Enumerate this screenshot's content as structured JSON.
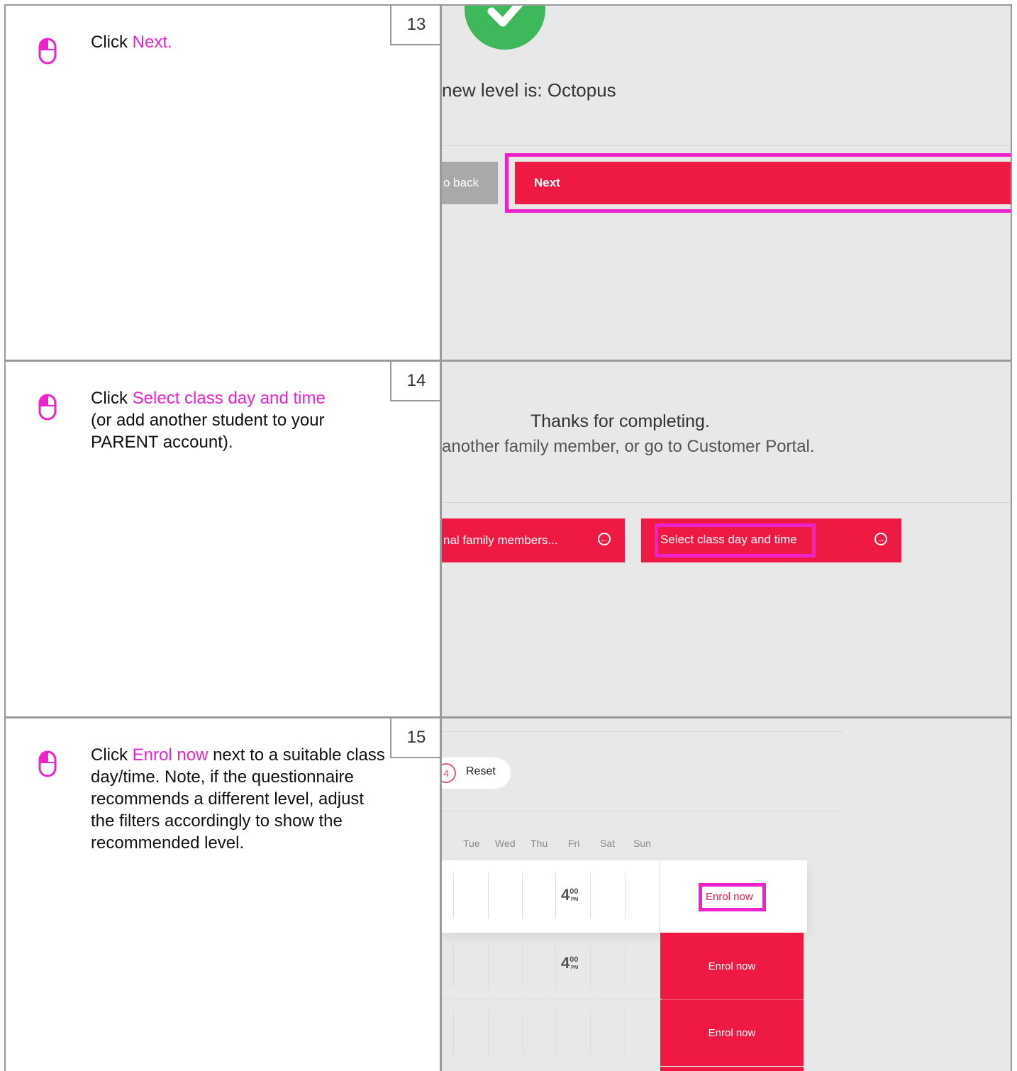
{
  "steps": [
    {
      "number": "13",
      "instruction": {
        "prefix": "Click ",
        "highlight": "Next."
      },
      "screen": {
        "level_text": "new level is: Octopus",
        "back_label": "o back",
        "next_label": "Next"
      }
    },
    {
      "number": "14",
      "instruction": {
        "prefix": "Click ",
        "highlight": "Select class day and time",
        "suffix": "(or add another student to your PARENT account)."
      },
      "screen": {
        "thanks": "Thanks for completing.",
        "subtitle": "another family member, or go to Customer Portal.",
        "family_button": "nal family members...",
        "select_button": "Select class day and time"
      }
    },
    {
      "number": "15",
      "instruction": {
        "prefix": "Click ",
        "highlight": "Enrol now",
        "suffix": " next to a suitable class day/time. Note, if the questionnaire recommends a different level, adjust the filters accordingly to show the recommended level."
      },
      "screen": {
        "reset_icon": "4",
        "reset_label": "Reset",
        "days": [
          "Tue",
          "Wed",
          "Thu",
          "Fri",
          "Sat",
          "Sun"
        ],
        "rows": [
          {
            "time_hour": "4",
            "time_min": "00",
            "time_period": "PM",
            "enrol": "Enrol now"
          },
          {
            "time_hour": "4",
            "time_min": "00",
            "time_period": "PM",
            "enrol": "Enrol now"
          },
          {
            "time_hour": "",
            "time_min": "",
            "time_period": "",
            "enrol": "Enrol now"
          }
        ]
      }
    }
  ],
  "icons": {
    "mouse": "mouse-left-click-icon",
    "check": "check-circle-icon",
    "arrow_left": "arrow-left-circle-icon",
    "arrow_right": "arrow-right-circle-icon"
  },
  "colors": {
    "highlight": "#ee22cc",
    "brand_red": "#ee1a44",
    "success_green": "#3db85a",
    "border_gray": "#9a9a9a"
  }
}
